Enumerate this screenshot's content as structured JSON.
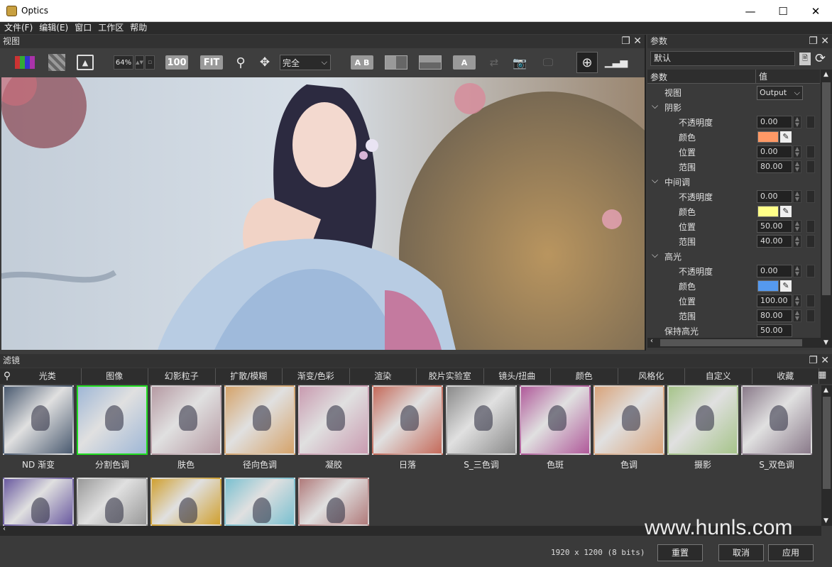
{
  "window": {
    "title": "Optics",
    "min_icon": "minimize-icon",
    "max_icon": "maximize-icon",
    "close_icon": "close-icon"
  },
  "menu": [
    "文件(F)",
    "编辑(E)",
    "窗口",
    "工作区",
    "帮助"
  ],
  "view_panel": {
    "title": "视图",
    "zoom": "64%",
    "btn_100": "100",
    "btn_fit": "FIT",
    "mode": "完全",
    "ab": "A B",
    "a_label": "A"
  },
  "params_panel": {
    "title": "参数",
    "preset": "默认",
    "col_param": "参数",
    "col_value": "值",
    "view_label": "视图",
    "view_value": "Output",
    "groups": [
      {
        "name": "阴影",
        "rows": [
          {
            "label": "不透明度",
            "value": "0.00"
          },
          {
            "label": "颜色",
            "color": "#ff9966"
          },
          {
            "label": "位置",
            "value": "0.00"
          },
          {
            "label": "范围",
            "value": "80.00"
          }
        ]
      },
      {
        "name": "中间调",
        "rows": [
          {
            "label": "不透明度",
            "value": "0.00"
          },
          {
            "label": "颜色",
            "color": "#ffff88"
          },
          {
            "label": "位置",
            "value": "50.00"
          },
          {
            "label": "范围",
            "value": "40.00"
          }
        ]
      },
      {
        "name": "高光",
        "rows": [
          {
            "label": "不透明度",
            "value": "0.00"
          },
          {
            "label": "颜色",
            "color": "#5599ee"
          },
          {
            "label": "位置",
            "value": "100.00"
          },
          {
            "label": "范围",
            "value": "80.00"
          }
        ]
      }
    ],
    "keep_highlight": "保持高光",
    "keep_value": "50.00"
  },
  "filters_panel": {
    "title": "滤镜",
    "tabs": [
      "光类",
      "图像",
      "幻影粒子",
      "扩散/模糊",
      "渐变/色彩",
      "渲染",
      "胶片实验室",
      "镜头/扭曲",
      "颜色",
      "风格化",
      "自定义",
      "收藏"
    ],
    "thumbs": [
      "ND 渐变",
      "分割色调",
      "肤色",
      "径向色调",
      "凝胶",
      "日落",
      "S_三色调",
      "色斑",
      "色调",
      "摄影",
      "S_双色调"
    ]
  },
  "status": {
    "info": "1920 x 1200 (8 bits)",
    "reset": "重置",
    "cancel": "取消",
    "apply": "应用"
  },
  "watermark": "www.hunls.com"
}
